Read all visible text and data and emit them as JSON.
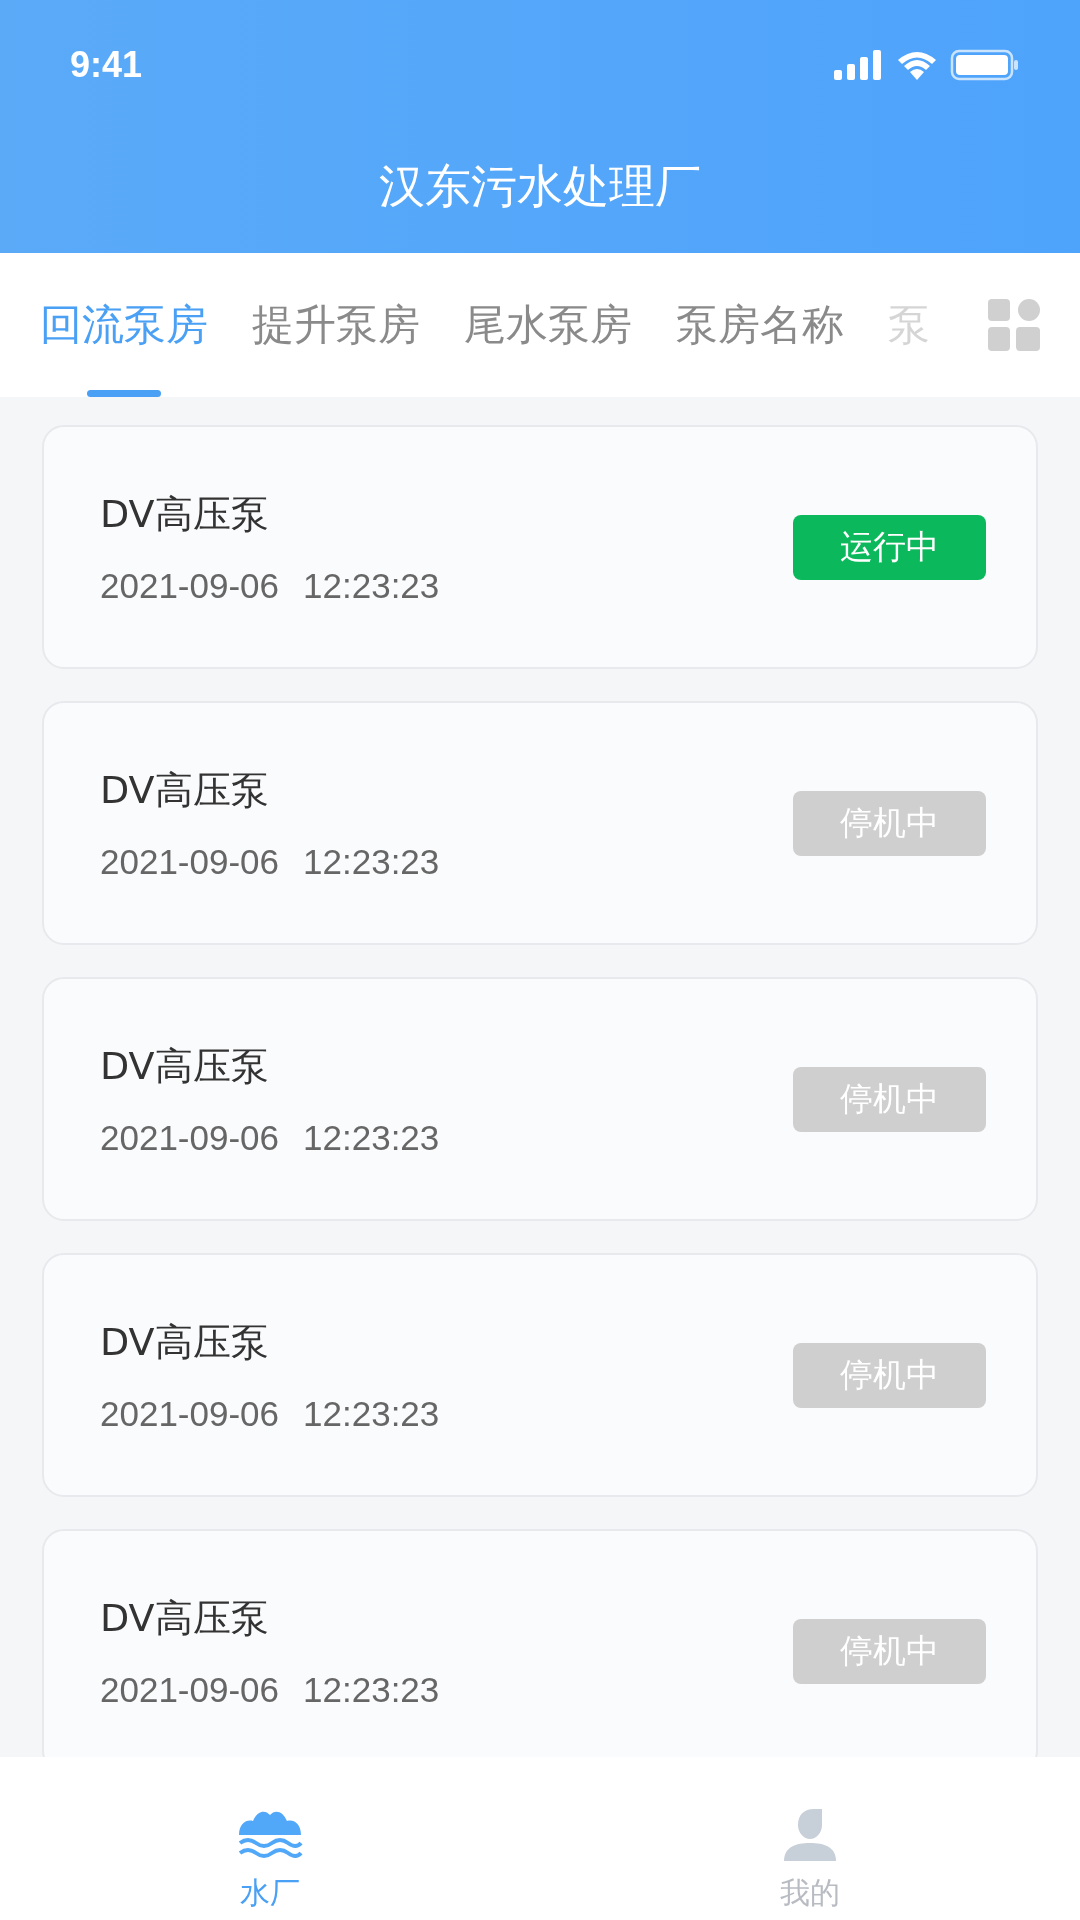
{
  "status_bar": {
    "time": "9:41"
  },
  "header": {
    "title": "汉东污水处理厂"
  },
  "tabs": [
    {
      "label": "回流泵房",
      "selected": true
    },
    {
      "label": "提升泵房",
      "selected": false
    },
    {
      "label": "尾水泵房",
      "selected": false
    },
    {
      "label": "泵房名称",
      "selected": false
    },
    {
      "label": "泵",
      "selected": false
    }
  ],
  "pumps": [
    {
      "name": "DV高压泵",
      "date": "2021-09-06",
      "time": "12:23:23",
      "status": {
        "label": "运行中",
        "kind": "running"
      }
    },
    {
      "name": "DV高压泵",
      "date": "2021-09-06",
      "time": "12:23:23",
      "status": {
        "label": "停机中",
        "kind": "stopped"
      }
    },
    {
      "name": "DV高压泵",
      "date": "2021-09-06",
      "time": "12:23:23",
      "status": {
        "label": "停机中",
        "kind": "stopped"
      }
    },
    {
      "name": "DV高压泵",
      "date": "2021-09-06",
      "time": "12:23:23",
      "status": {
        "label": "停机中",
        "kind": "stopped"
      }
    },
    {
      "name": "DV高压泵",
      "date": "2021-09-06",
      "time": "12:23:23",
      "status": {
        "label": "停机中",
        "kind": "stopped"
      }
    }
  ],
  "bottom_nav": [
    {
      "label": "水厂",
      "selected": true,
      "kind": "plant"
    },
    {
      "label": "我的",
      "selected": false,
      "kind": "profile"
    }
  ]
}
